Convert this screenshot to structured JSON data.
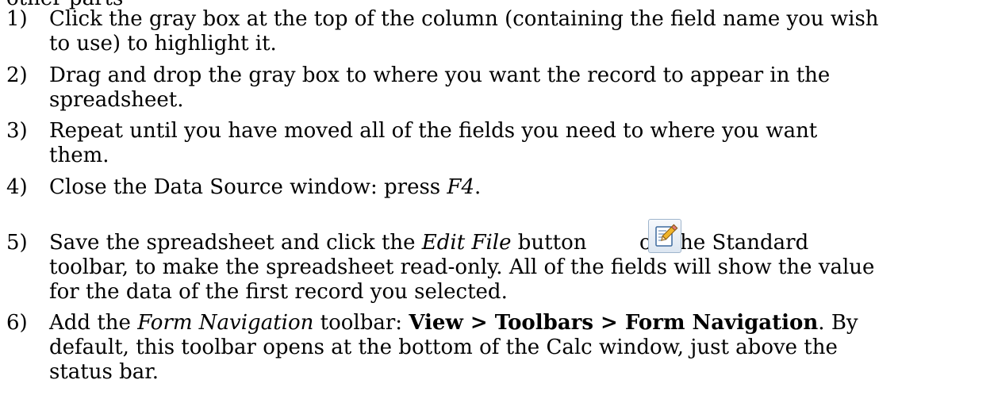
{
  "cutoff_line": "other parts",
  "steps": [
    {
      "number": "1)",
      "line1": "Click the gray box at the top of the column (containing the field name you wish",
      "line2": "to use) to highlight it."
    },
    {
      "number": "2)",
      "line1": "Drag and drop the gray box to where you want the record to appear in the",
      "line2": "spreadsheet."
    },
    {
      "number": "3)",
      "line1": "Repeat until you have moved all of the fields you need to where you want",
      "line2": "them."
    },
    {
      "number": "4)",
      "text_a": "Close the Data Source window: press ",
      "key": "F4",
      "text_b": "."
    },
    {
      "number": "5)",
      "text_a": "Save the spreadsheet and click the ",
      "button_name": "Edit File",
      "text_b": " button ",
      "icon": "edit-file-pencil-icon",
      "text_c": " on the Standard",
      "line2": "toolbar, to make the spreadsheet read-only. All of the fields will show the value",
      "line3": "for the data of the first record you selected."
    },
    {
      "number": "6)",
      "text_a": "Add the ",
      "toolbar_name": "Form Navigation",
      "text_b": " toolbar: ",
      "menu_path": "View > Toolbars > Form Navigation",
      "text_c": ". By",
      "line2": "default, this toolbar opens at the bottom of the Calc window, just above the",
      "line3": "status bar."
    }
  ]
}
